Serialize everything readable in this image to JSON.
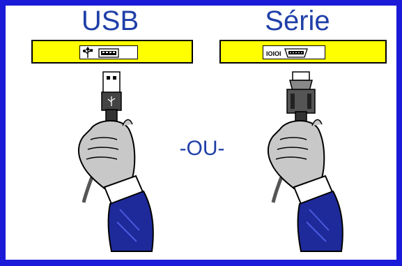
{
  "labels": {
    "usb": "USB",
    "serie": "Série",
    "or": "-OU-"
  },
  "icons": {
    "usb_strip": [
      "usb-trident-icon",
      "usb-port-icon"
    ],
    "serie_strip": [
      "binary-10101-icon",
      "serial-db9-port-icon"
    ],
    "left_hand": "hand-holding-usb-cable-icon",
    "right_hand": "hand-holding-serial-cable-icon"
  },
  "strip_marks": {
    "binary": "IOIOI"
  },
  "colors": {
    "frame": "#1a1ad8",
    "label_text": "#1f3fa8",
    "strip": "#ffff00",
    "sleeve": "#1e2a9a",
    "hand": "#c8c8c8",
    "connector": "#4a4a4a"
  }
}
